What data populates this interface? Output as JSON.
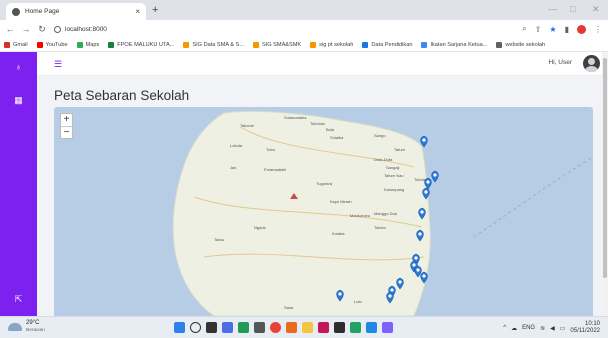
{
  "browser": {
    "tab_title": "Home Page",
    "tab_close": "×",
    "new_tab": "+",
    "url": "localhost:8000",
    "bookmarks": [
      {
        "label": "Gmail",
        "color": "#d93025"
      },
      {
        "label": "YouTube",
        "color": "#ff0000"
      },
      {
        "label": "Maps",
        "color": "#34a853"
      },
      {
        "label": "FPOE MALUKU UTA...",
        "color": "#188038"
      },
      {
        "label": "SIG Data SMA & S...",
        "color": "#f29900"
      },
      {
        "label": "SIG SMA&SMK",
        "color": "#f29900"
      },
      {
        "label": "sig pt sekolah",
        "color": "#f29900"
      },
      {
        "label": "Data Pendidikan",
        "color": "#1a73e8"
      },
      {
        "label": "Ikatan Sarjana Ketua...",
        "color": "#4285f4"
      },
      {
        "label": "website sekolah",
        "color": "#5f6368"
      }
    ]
  },
  "app": {
    "brand_color": "#7c21f0",
    "user_greeting": "Hi, User",
    "menu_icon": "hamburger-icon",
    "page_title": "Peta Sebaran Sekolah"
  },
  "map": {
    "zoom_in": "+",
    "zoom_out": "−",
    "place_labels": [
      "Sulamadaha",
      "Takome",
      "Tobololo",
      "Bula",
      "Sulaiba",
      "Sango",
      "Loloda",
      "Tubo",
      "Tafure",
      "Dufa-Dufa",
      "Sangaji",
      "Tafure Nau",
      "Toboleu",
      "Jan",
      "Foramadiahi",
      "Tugurara",
      "Kalumpang",
      "Mangga Dua",
      "Tobelo",
      "Marikurubu",
      "Kulaba",
      "Kayu Merah",
      "Ngade",
      "Tarau",
      "Sasa",
      "Loto"
    ],
    "marker_color": "#2b7bd6"
  },
  "taskbar": {
    "temperature": "29°C",
    "weather": "Berawan",
    "language": "ENG",
    "time": "10:10",
    "date": "05/11/2022"
  }
}
